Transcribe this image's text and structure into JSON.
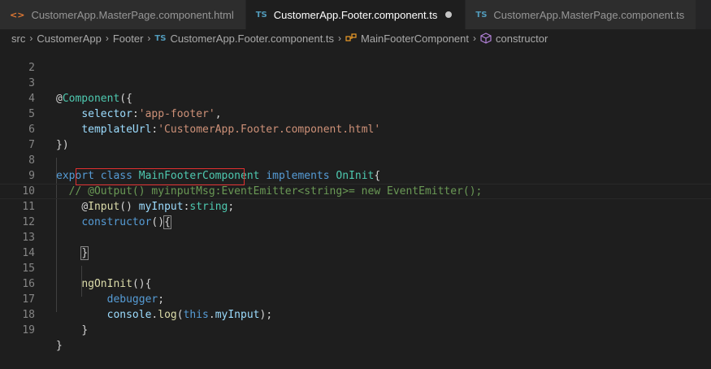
{
  "tabs": [
    {
      "icon": "<>",
      "label": "CustomerApp.MasterPage.component.html",
      "active": false
    },
    {
      "icon": "TS",
      "label": "CustomerApp.Footer.component.ts",
      "active": true,
      "dirty": true
    },
    {
      "icon": "TS",
      "label": "CustomerApp.MasterPage.component.ts",
      "active": false
    }
  ],
  "breadcrumb": {
    "src": "src",
    "folder1": "CustomerApp",
    "folder2": "Footer",
    "file_icon": "TS",
    "file": "CustomerApp.Footer.component.ts",
    "class": "MainFooterComponent",
    "member": "constructor"
  },
  "colors": {
    "keyword": "#569cd6",
    "type": "#4ec9b0",
    "function": "#dcdcaa",
    "property": "#9cdcfe",
    "string": "#ce9178",
    "comment": "#6a9955",
    "highlight_box": "#e03030"
  },
  "editor": {
    "lines": [
      {
        "n": "2"
      },
      {
        "n": "3",
        "t": [
          "@",
          "Component",
          "({"
        ]
      },
      {
        "n": "4",
        "t": [
          "    ",
          "selector",
          ":",
          "'app-footer'",
          ","
        ]
      },
      {
        "n": "5",
        "t": [
          "    ",
          "templateUrl",
          ":",
          "'CustomerApp.Footer.component.html'"
        ]
      },
      {
        "n": "6",
        "t": [
          "})"
        ]
      },
      {
        "n": "7"
      },
      {
        "n": "8",
        "t": [
          "export",
          " ",
          "class",
          " ",
          "MainFooterComponent",
          " ",
          "implements",
          " ",
          "OnInit",
          "{"
        ]
      },
      {
        "n": "9",
        "t": [
          "  // @Output() myinputMsg:EventEmitter<string>= new EventEmitter();"
        ]
      },
      {
        "n": "10",
        "t": [
          "    ",
          "@",
          "Input",
          "() ",
          "myInput",
          ":",
          "string",
          ";"
        ]
      },
      {
        "n": "11",
        "t": [
          "    ",
          "constructor",
          "()",
          "{"
        ]
      },
      {
        "n": "12"
      },
      {
        "n": "13",
        "t": [
          "    ",
          "}"
        ]
      },
      {
        "n": "14"
      },
      {
        "n": "15",
        "t": [
          "    ",
          "ngOnInit",
          "(){"
        ]
      },
      {
        "n": "16",
        "t": [
          "        ",
          "debugger",
          ";"
        ]
      },
      {
        "n": "17",
        "t": [
          "        ",
          "console",
          ".",
          "log",
          "(",
          "this",
          ".",
          "myInput",
          ");"
        ]
      },
      {
        "n": "18",
        "t": [
          "    ",
          "}"
        ]
      },
      {
        "n": "19",
        "t": [
          "}"
        ]
      }
    ]
  }
}
